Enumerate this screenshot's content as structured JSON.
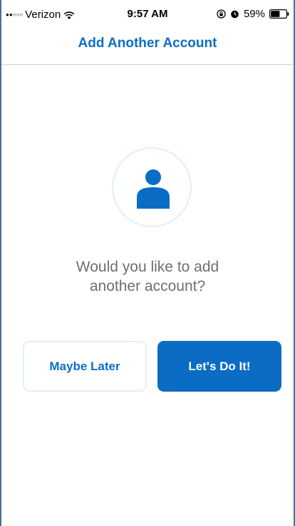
{
  "status_bar": {
    "carrier": "Verizon",
    "time": "9:57 AM",
    "battery_percent": "59%",
    "battery_level": 0.59,
    "signal_bars_filled": 2,
    "signal_bars_total": 5,
    "icons": [
      "wifi-icon",
      "rotation-lock-icon",
      "alarm-icon",
      "battery-icon"
    ]
  },
  "nav": {
    "title": "Add Another Account"
  },
  "main": {
    "avatar_icon": "person-icon",
    "prompt_line1": "Would you like to add",
    "prompt_line2": "another account?",
    "later_label": "Maybe Later",
    "confirm_label": "Let's Do It!"
  },
  "colors": {
    "accent": "#0b6cc4",
    "text_muted": "#6f6f6f",
    "border_light": "#e3eef8"
  }
}
